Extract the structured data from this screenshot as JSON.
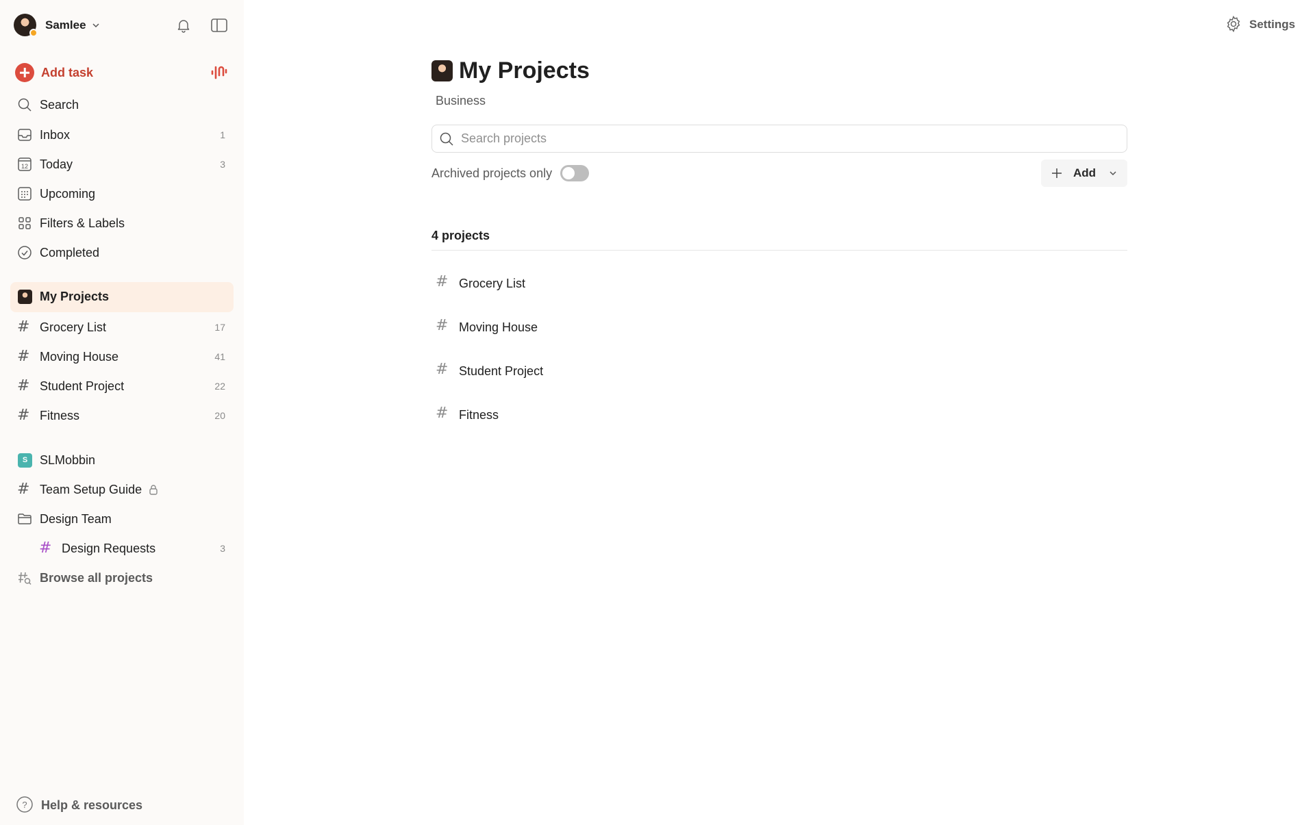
{
  "user": {
    "name": "Samlee"
  },
  "add_task": {
    "label": "Add task"
  },
  "nav": [
    {
      "label": "Search",
      "count": ""
    },
    {
      "label": "Inbox",
      "count": "1"
    },
    {
      "label": "Today",
      "count": "3",
      "day": "12"
    },
    {
      "label": "Upcoming",
      "count": ""
    },
    {
      "label": "Filters & Labels",
      "count": ""
    },
    {
      "label": "Completed",
      "count": ""
    }
  ],
  "my_projects": {
    "label": "My Projects",
    "items": [
      {
        "label": "Grocery List",
        "count": "17"
      },
      {
        "label": "Moving House",
        "count": "41"
      },
      {
        "label": "Student Project",
        "count": "22"
      },
      {
        "label": "Fitness",
        "count": "20"
      }
    ]
  },
  "team": {
    "badge": "S",
    "label": "SLMobbin",
    "items": [
      {
        "label": "Team Setup Guide",
        "count": ""
      },
      {
        "label": "Design Team",
        "count": ""
      },
      {
        "label": "Design Requests",
        "count": "3"
      }
    ],
    "browse_label": "Browse all projects"
  },
  "help": {
    "label": "Help & resources"
  },
  "settings": {
    "label": "Settings"
  },
  "page": {
    "title": "My Projects",
    "subtitle": "Business",
    "search_placeholder": "Search projects",
    "archived_label": "Archived projects only",
    "archived_on": false,
    "add_label": "Add",
    "count_label": "4 projects",
    "projects": [
      "Grocery List",
      "Moving House",
      "Student Project",
      "Fitness"
    ]
  },
  "colors": {
    "accent": "#dc4c3e",
    "active_bg": "#fdefe4",
    "sidebar_bg": "#fcfaf8",
    "team_badge": "#4ab4ae",
    "design_hash": "#a950c8"
  }
}
